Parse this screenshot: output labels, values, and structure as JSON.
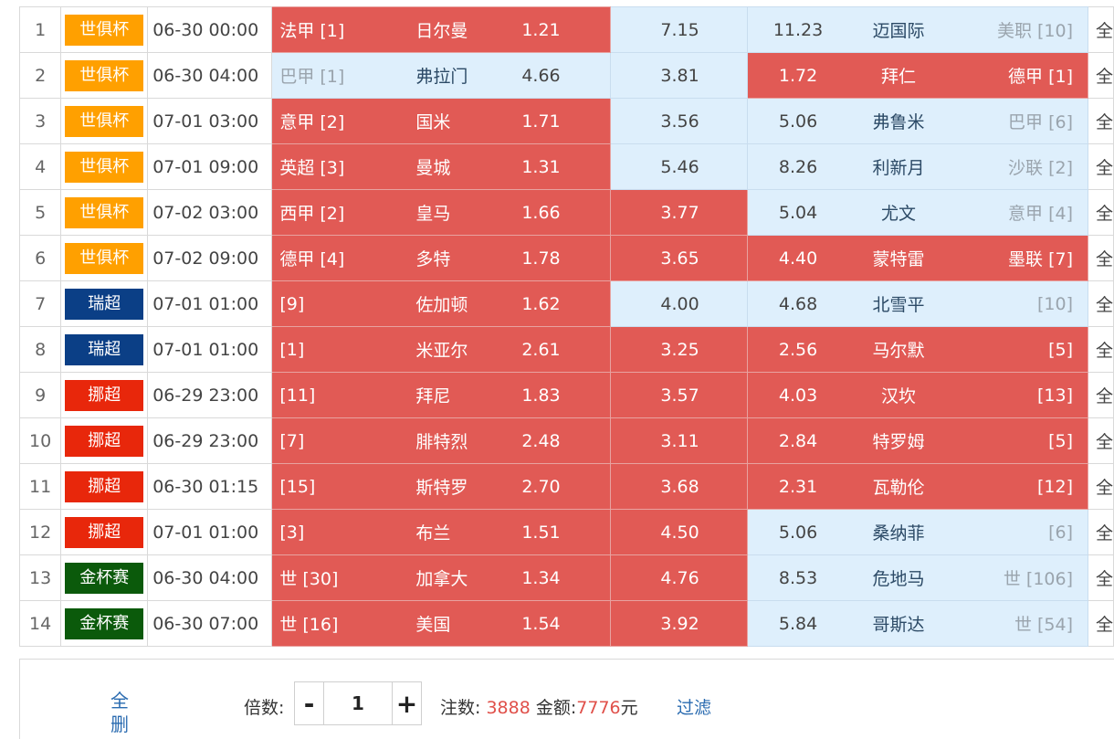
{
  "colors": {
    "badge_club_world_cup": "#ffa000",
    "badge_swiss": "#0b3f86",
    "badge_norway": "#e8270b",
    "badge_gold_cup": "#0b5a0b",
    "selected_cell": "#e15a55",
    "unselected_cell": "#deeffc",
    "highlight_text": "#e0504a",
    "link_text": "#2a6bb0"
  },
  "matches": [
    {
      "no": "1",
      "league": "世俱杯",
      "league_color": "#ffa000",
      "time": "06-30 00:00",
      "home_rank": "法甲 [1]",
      "home_team": "日尔曼",
      "home_odd": "1.21",
      "home_sel": true,
      "draw_odd": "7.15",
      "draw_sel": false,
      "away_odd": "11.23",
      "away_team": "迈国际",
      "away_rank": "美职 [10]",
      "away_sel": false,
      "extra": "全"
    },
    {
      "no": "2",
      "league": "世俱杯",
      "league_color": "#ffa000",
      "time": "06-30 04:00",
      "home_rank": "巴甲 [1]",
      "home_team": "弗拉门",
      "home_odd": "4.66",
      "home_sel": false,
      "draw_odd": "3.81",
      "draw_sel": false,
      "away_odd": "1.72",
      "away_team": "拜仁",
      "away_rank": "德甲 [1]",
      "away_sel": true,
      "extra": "全"
    },
    {
      "no": "3",
      "league": "世俱杯",
      "league_color": "#ffa000",
      "time": "07-01 03:00",
      "home_rank": "意甲 [2]",
      "home_team": "国米",
      "home_odd": "1.71",
      "home_sel": true,
      "draw_odd": "3.56",
      "draw_sel": false,
      "away_odd": "5.06",
      "away_team": "弗鲁米",
      "away_rank": "巴甲 [6]",
      "away_sel": false,
      "extra": "全"
    },
    {
      "no": "4",
      "league": "世俱杯",
      "league_color": "#ffa000",
      "time": "07-01 09:00",
      "home_rank": "英超 [3]",
      "home_team": "曼城",
      "home_odd": "1.31",
      "home_sel": true,
      "draw_odd": "5.46",
      "draw_sel": false,
      "away_odd": "8.26",
      "away_team": "利新月",
      "away_rank": "沙联 [2]",
      "away_sel": false,
      "extra": "全"
    },
    {
      "no": "5",
      "league": "世俱杯",
      "league_color": "#ffa000",
      "time": "07-02 03:00",
      "home_rank": "西甲 [2]",
      "home_team": "皇马",
      "home_odd": "1.66",
      "home_sel": true,
      "draw_odd": "3.77",
      "draw_sel": true,
      "away_odd": "5.04",
      "away_team": "尤文",
      "away_rank": "意甲 [4]",
      "away_sel": false,
      "extra": "全"
    },
    {
      "no": "6",
      "league": "世俱杯",
      "league_color": "#ffa000",
      "time": "07-02 09:00",
      "home_rank": "德甲 [4]",
      "home_team": "多特",
      "home_odd": "1.78",
      "home_sel": true,
      "draw_odd": "3.65",
      "draw_sel": true,
      "away_odd": "4.40",
      "away_team": "蒙特雷",
      "away_rank": "墨联 [7]",
      "away_sel": true,
      "extra": "全"
    },
    {
      "no": "7",
      "league": "瑞超",
      "league_color": "#0b3f86",
      "time": "07-01 01:00",
      "home_rank": "[9]",
      "home_team": "佐加顿",
      "home_odd": "1.62",
      "home_sel": true,
      "draw_odd": "4.00",
      "draw_sel": false,
      "away_odd": "4.68",
      "away_team": "北雪平",
      "away_rank": "[10]",
      "away_sel": false,
      "extra": "全"
    },
    {
      "no": "8",
      "league": "瑞超",
      "league_color": "#0b3f86",
      "time": "07-01 01:00",
      "home_rank": "[1]",
      "home_team": "米亚尔",
      "home_odd": "2.61",
      "home_sel": true,
      "draw_odd": "3.25",
      "draw_sel": true,
      "away_odd": "2.56",
      "away_team": "马尔默",
      "away_rank": "[5]",
      "away_sel": true,
      "extra": "全"
    },
    {
      "no": "9",
      "league": "挪超",
      "league_color": "#e8270b",
      "time": "06-29 23:00",
      "home_rank": "[11]",
      "home_team": "拜尼",
      "home_odd": "1.83",
      "home_sel": true,
      "draw_odd": "3.57",
      "draw_sel": true,
      "away_odd": "4.03",
      "away_team": "汉坎",
      "away_rank": "[13]",
      "away_sel": true,
      "extra": "全"
    },
    {
      "no": "10",
      "league": "挪超",
      "league_color": "#e8270b",
      "time": "06-29 23:00",
      "home_rank": "[7]",
      "home_team": "腓特烈",
      "home_odd": "2.48",
      "home_sel": true,
      "draw_odd": "3.11",
      "draw_sel": true,
      "away_odd": "2.84",
      "away_team": "特罗姆",
      "away_rank": "[5]",
      "away_sel": true,
      "extra": "全"
    },
    {
      "no": "11",
      "league": "挪超",
      "league_color": "#e8270b",
      "time": "06-30 01:15",
      "home_rank": "[15]",
      "home_team": "斯特罗",
      "home_odd": "2.70",
      "home_sel": true,
      "draw_odd": "3.68",
      "draw_sel": true,
      "away_odd": "2.31",
      "away_team": "瓦勒伦",
      "away_rank": "[12]",
      "away_sel": true,
      "extra": "全"
    },
    {
      "no": "12",
      "league": "挪超",
      "league_color": "#e8270b",
      "time": "07-01 01:00",
      "home_rank": "[3]",
      "home_team": "布兰",
      "home_odd": "1.51",
      "home_sel": true,
      "draw_odd": "4.50",
      "draw_sel": true,
      "away_odd": "5.06",
      "away_team": "桑纳菲",
      "away_rank": "[6]",
      "away_sel": false,
      "extra": "全"
    },
    {
      "no": "13",
      "league": "金杯赛",
      "league_color": "#0b5a0b",
      "time": "06-30 04:00",
      "home_rank": "世 [30]",
      "home_team": "加拿大",
      "home_odd": "1.34",
      "home_sel": true,
      "draw_odd": "4.76",
      "draw_sel": true,
      "away_odd": "8.53",
      "away_team": "危地马",
      "away_rank": "世 [106]",
      "away_sel": false,
      "extra": "全"
    },
    {
      "no": "14",
      "league": "金杯赛",
      "league_color": "#0b5a0b",
      "time": "06-30 07:00",
      "home_rank": "世 [16]",
      "home_team": "美国",
      "home_odd": "1.54",
      "home_sel": true,
      "draw_odd": "3.92",
      "draw_sel": true,
      "away_odd": "5.84",
      "away_team": "哥斯达",
      "away_rank": "世 [54]",
      "away_sel": false,
      "extra": "全"
    }
  ],
  "footer": {
    "clear_label": "全删",
    "multiplier_label": "倍数:",
    "minus_label": "-",
    "plus_label": "+",
    "multiplier_value": "1",
    "bets_label": "注数:",
    "bets_value": "3888",
    "amount_label": "金额:",
    "amount_value": "7776",
    "currency": "元",
    "filter_label": "过滤"
  }
}
